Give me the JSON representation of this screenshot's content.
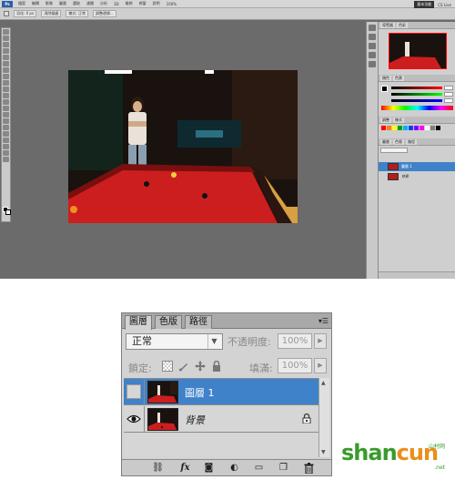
{
  "photoshop": {
    "logo": "Ps",
    "menu_items": [
      "檔案",
      "編輯",
      "影像",
      "圖層",
      "選取",
      "濾鏡",
      "分析",
      "3D",
      "檢視",
      "視窗",
      "說明"
    ],
    "workspace": "基本功能",
    "cs_live": "CS Live",
    "options": {
      "feather_label": "羽化: 0 px",
      "antialias": "消除鋸齒",
      "style_label": "樣式: 正常",
      "refine_edge": "調整邊緣..."
    },
    "zoom": "100%",
    "navigator_tabs": [
      "導覽器",
      "色彩"
    ],
    "color_tabs": [
      "顏色",
      "色票"
    ],
    "styles_tabs": [
      "調整",
      "樣式"
    ],
    "layers_mini_tabs": [
      "圖層",
      "色版",
      "路徑"
    ],
    "mini_layers": [
      {
        "name": "圖層 1"
      },
      {
        "name": "背景"
      }
    ],
    "swatch_colors": [
      "#ff0000",
      "#ff7f00",
      "#ffff00",
      "#00a000",
      "#00b0ff",
      "#0040ff",
      "#8000ff",
      "#ff00ff",
      "#ffffff",
      "#808080",
      "#000000"
    ]
  },
  "layers_panel": {
    "tabs": [
      {
        "label": "圖層",
        "active": true
      },
      {
        "label": "色版",
        "active": false
      },
      {
        "label": "路徑",
        "active": false
      }
    ],
    "menu_icon": "panel-menu-icon",
    "blend_mode": "正常",
    "opacity_label": "不透明度:",
    "opacity_value": "100%",
    "lock_label": "鎖定:",
    "fill_label": "填滿:",
    "fill_value": "100%",
    "layers": [
      {
        "name": "圖層 1",
        "visible": false,
        "selected": true,
        "locked": false
      },
      {
        "name": "背景",
        "visible": true,
        "selected": false,
        "locked": true
      }
    ],
    "footer_icons": [
      "link-icon",
      "fx-icon",
      "mask-icon",
      "adjustment-icon",
      "group-folder-icon",
      "new-layer-icon",
      "trash-icon"
    ],
    "footer_glyphs": [
      "⛓",
      "fx",
      "◙",
      "◐",
      "▭",
      "❐",
      "🗑"
    ]
  },
  "watermark": {
    "brand_green": "shan",
    "brand_orange": "cun",
    "suffix": ".net",
    "sub": "山村网",
    "colors": {
      "green": "#3a9a2b",
      "orange": "#e8901a"
    }
  }
}
